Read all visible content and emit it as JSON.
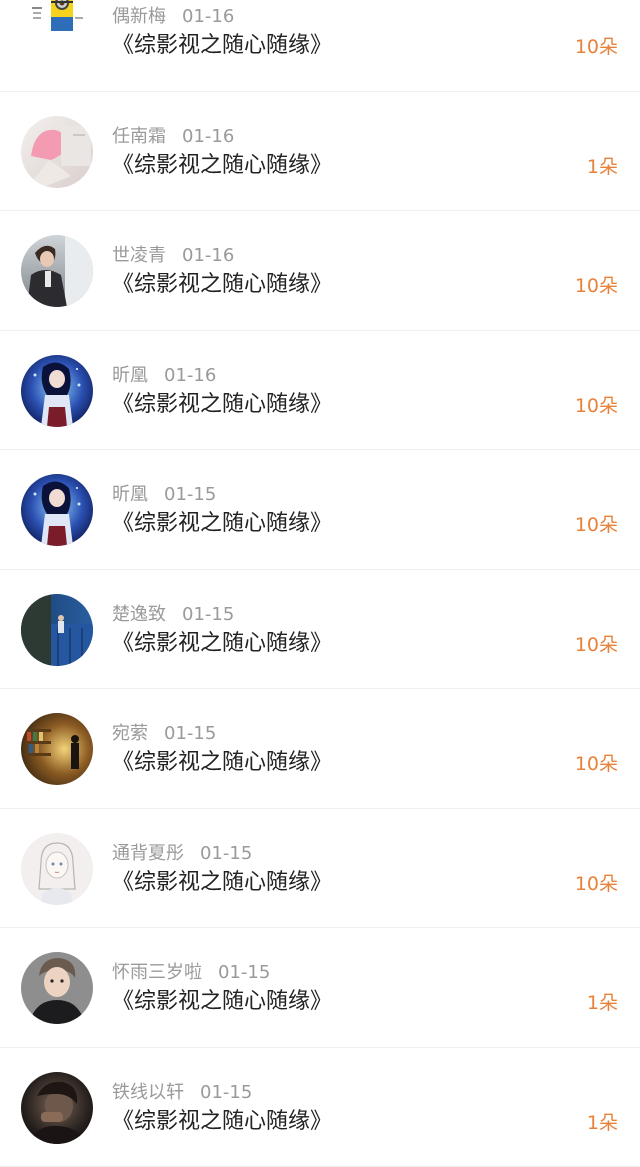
{
  "colors": {
    "amount": "#e8823a",
    "name": "#9a9a9a",
    "title": "#222222",
    "divider": "#f0f0f0"
  },
  "gifts": [
    {
      "name": "偶新梅",
      "date": "01-16",
      "title": "《综影视之随心随缘》",
      "amount": "10朵",
      "avatar": "minion-avatar"
    },
    {
      "name": "任南霜",
      "date": "01-16",
      "title": "《综影视之随心随缘》",
      "amount": "1朵",
      "avatar": "pink-hair-avatar"
    },
    {
      "name": "世凌青",
      "date": "01-16",
      "title": "《综影视之随心随缘》",
      "amount": "10朵",
      "avatar": "man-suit-avatar"
    },
    {
      "name": "昕凰",
      "date": "01-16",
      "title": "《综影视之随心随缘》",
      "amount": "10朵",
      "avatar": "anime-girl-avatar"
    },
    {
      "name": "昕凰",
      "date": "01-15",
      "title": "《综影视之随心随缘》",
      "amount": "10朵",
      "avatar": "anime-girl-avatar"
    },
    {
      "name": "楚逸致",
      "date": "01-15",
      "title": "《综影视之随心随缘》",
      "amount": "10朵",
      "avatar": "blue-door-avatar"
    },
    {
      "name": "宛萦",
      "date": "01-15",
      "title": "《综影视之随心随缘》",
      "amount": "10朵",
      "avatar": "bookstore-avatar"
    },
    {
      "name": "通背夏彤",
      "date": "01-15",
      "title": "《综影视之随心随缘》",
      "amount": "10朵",
      "avatar": "sketch-girl-avatar"
    },
    {
      "name": "怀雨三岁啦",
      "date": "01-15",
      "title": "《综影视之随心随缘》",
      "amount": "1朵",
      "avatar": "young-man-avatar"
    },
    {
      "name": "铁线以轩",
      "date": "01-15",
      "title": "《综影视之随心随缘》",
      "amount": "1朵",
      "avatar": "dark-portrait-avatar"
    }
  ]
}
